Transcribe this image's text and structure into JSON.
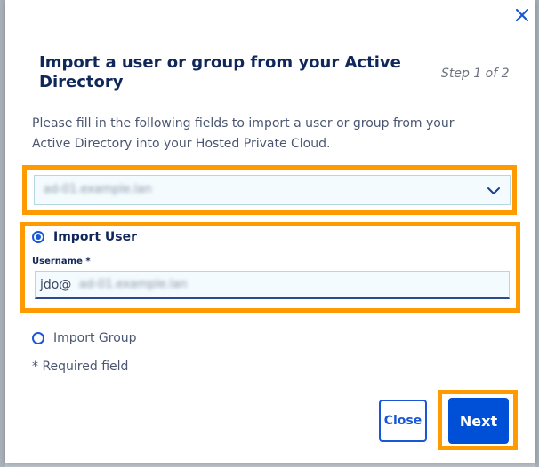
{
  "dialog": {
    "title": "Import a user or group from your Active Directory",
    "step": "Step 1 of 2",
    "description": "Please fill in the following fields to import a user or group from your Active Directory into your Hosted Private Cloud."
  },
  "directory_select": {
    "value": "ad-01.example.lan",
    "icon": "chevron-down-icon"
  },
  "import_user": {
    "label": "Import User",
    "selected": true
  },
  "username": {
    "label": "Username *",
    "value_prefix": "jdo@",
    "value_obscured": "ad-01.example.lan"
  },
  "import_group": {
    "label": "Import Group",
    "selected": false
  },
  "required_note": "* Required field",
  "buttons": {
    "close": "Close",
    "next": "Next"
  },
  "colors": {
    "accent": "#0050d7",
    "highlight": "#ff9a00",
    "title": "#10275a"
  }
}
